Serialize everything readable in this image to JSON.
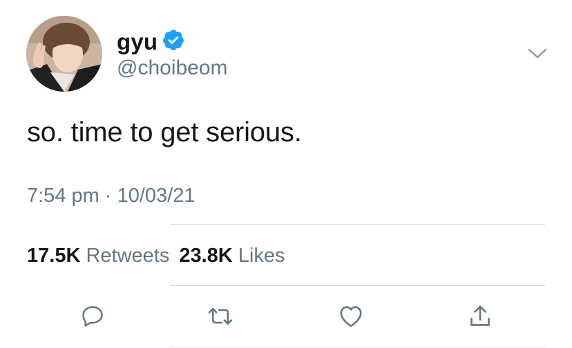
{
  "tweet": {
    "display_name": "gyu",
    "handle": "@choibeom",
    "text": "so. time to get serious.",
    "time": "7:54 pm",
    "separator": "·",
    "date": "10/03/21",
    "retweets_count": "17.5K",
    "retweets_label": "Retweets",
    "likes_count": "23.8K",
    "likes_label": "Likes"
  },
  "icons": {
    "verified": "verified-badge-icon",
    "menu": "chevron-down-icon",
    "reply": "reply-icon",
    "retweet": "retweet-icon",
    "like": "heart-icon",
    "share": "share-icon"
  },
  "colors": {
    "text_primary": "#14171a",
    "text_secondary": "#657786",
    "verified_blue": "#1da1f2",
    "divider": "#d6dbdf"
  }
}
